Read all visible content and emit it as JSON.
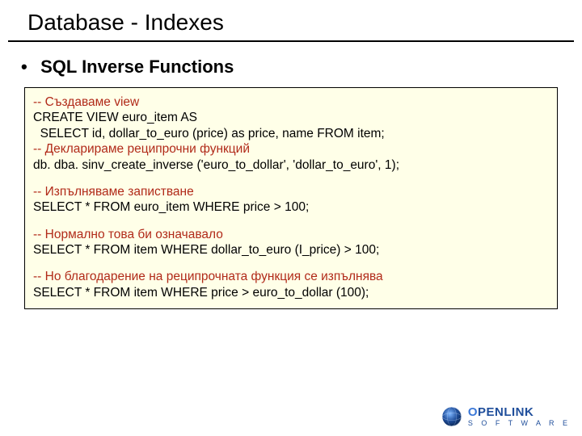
{
  "title": "Database - Indexes",
  "subtitle": "SQL Inverse Functions",
  "code": {
    "b1": {
      "c1": "-- Създаваме view",
      "l1": "CREATE VIEW euro_item AS",
      "l2": "  SELECT id, dollar_to_euro (price) as price, name FROM item;",
      "c2": "-- Декларираме реципрочни функций",
      "l3": "db. dba. sinv_create_inverse ('euro_to_dollar', 'dollar_to_euro', 1);"
    },
    "b2": {
      "c1": "-- Изпълняваме запистване",
      "l1": "SELECT * FROM euro_item WHERE price > 100;"
    },
    "b3": {
      "c1": "-- Нормално това би означавало",
      "l1": "SELECT * FROM item WHERE dollar_to_euro (I_price) > 100;"
    },
    "b4": {
      "c1": "-- Но благодарение на реципрочната функция се изпълнява",
      "l1": "SELECT * FROM item WHERE price > euro_to_dollar (100);"
    }
  },
  "logo": {
    "name_prefix": "O",
    "name_rest": "PENLINK",
    "sub": "S O F T W A R E"
  }
}
